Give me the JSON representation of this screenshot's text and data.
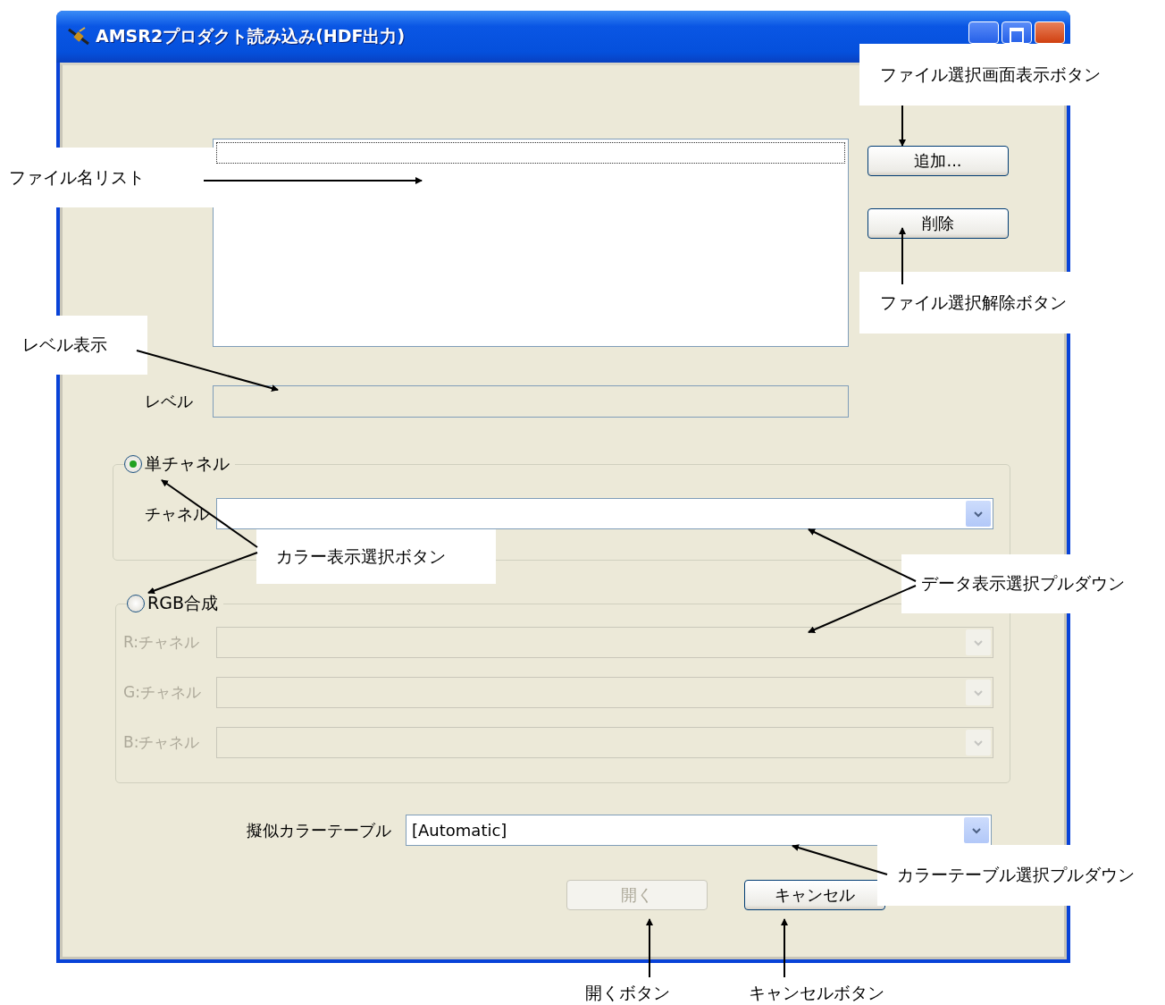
{
  "window": {
    "title": "AMSR2プロダクト読み込み(HDF出力)"
  },
  "side_buttons": [
    {
      "label": "追加..."
    },
    {
      "label": "削除"
    }
  ],
  "level": {
    "label": "レベル"
  },
  "single_channel": {
    "label": "単チャネル",
    "selected": true,
    "channel": {
      "label": "チャネル",
      "disabled": false
    }
  },
  "rgb": {
    "label": "RGB合成",
    "selected": false,
    "channels": [
      {
        "label": "R:チャネル",
        "disabled": true
      },
      {
        "label": "G:チャネル",
        "disabled": true
      },
      {
        "label": "B:チャネル",
        "disabled": true
      }
    ]
  },
  "color_table": {
    "label": "擬似カラーテーブル",
    "value": "[Automatic]"
  },
  "buttons": [
    {
      "label": "開く",
      "disabled": true
    },
    {
      "label": "キャンセル",
      "disabled": false
    }
  ],
  "annotations": [
    "ファイル選択画面表示ボタン",
    "ファイル名リスト",
    "ファイル選択解除ボタン",
    "レベル表示",
    "カラー表示選択ボタン",
    "データ表示選択プルダウン",
    "カラーテーブル選択プルダウン",
    "開くボタン",
    "キャンセルボタン"
  ]
}
